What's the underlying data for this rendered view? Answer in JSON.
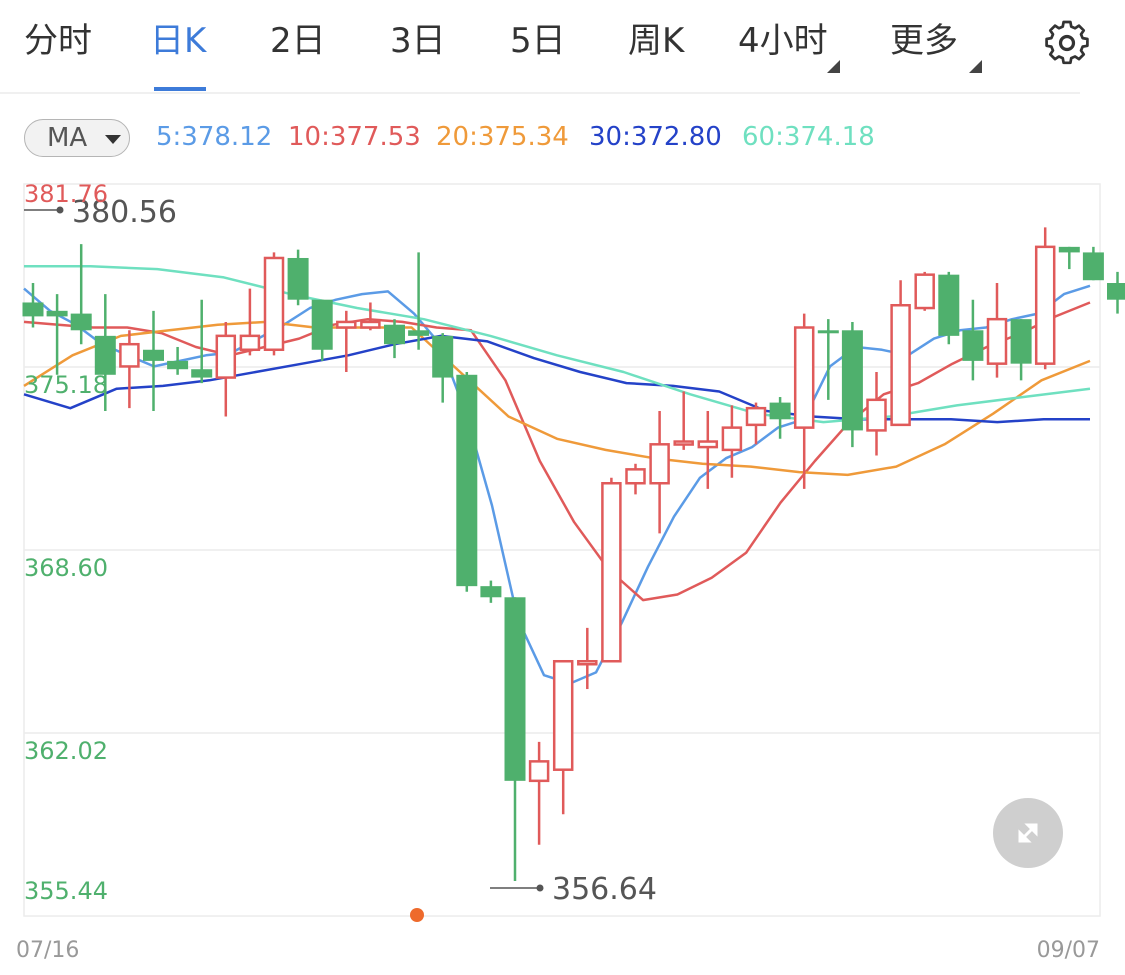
{
  "tabs": [
    {
      "label": "分时",
      "active": false
    },
    {
      "label": "日K",
      "active": true
    },
    {
      "label": "2日",
      "active": false
    },
    {
      "label": "3日",
      "active": false
    },
    {
      "label": "5日",
      "active": false
    },
    {
      "label": "周K",
      "active": false
    },
    {
      "label": "4小时",
      "active": false
    },
    {
      "label": "更多",
      "active": false
    }
  ],
  "settings_icon": "gear-icon",
  "expand_icon": "expand-arrows-icon",
  "indicator": {
    "selector_label": "MA",
    "values": [
      {
        "label": "5:378.12",
        "color": "#5b9be6"
      },
      {
        "label": "10:377.53",
        "color": "#e05a5a"
      },
      {
        "label": "20:375.34",
        "color": "#ef9a3a"
      },
      {
        "label": "30:372.80",
        "color": "#2442c8"
      },
      {
        "label": "60:374.18",
        "color": "#6fe0c0"
      }
    ]
  },
  "colors": {
    "up": "#e05a5a",
    "down": "#4fb06d",
    "accent": "#3d7bd9",
    "marker": "#ee6a2c"
  },
  "chart_data": {
    "type": "candlestick",
    "x_start_label": "07/16",
    "x_end_label": "09/07",
    "y_tick_labels": [
      "381.76",
      "375.18",
      "368.60",
      "362.02",
      "355.44"
    ],
    "ylim": [
      355.44,
      381.76
    ],
    "max_annotation": "380.56",
    "min_annotation": "356.64",
    "grid": true,
    "candles": [
      [
        377.5,
        377.0,
        378.2,
        376.6
      ],
      [
        377.2,
        377.0,
        377.8,
        374.9
      ],
      [
        377.1,
        376.5,
        379.6,
        376.0
      ],
      [
        376.3,
        374.9,
        377.8,
        373.6
      ],
      [
        375.2,
        376.0,
        376.5,
        373.7
      ],
      [
        375.8,
        375.4,
        377.2,
        373.6
      ],
      [
        375.4,
        375.1,
        375.9,
        374.9
      ],
      [
        375.1,
        374.8,
        377.6,
        374.6
      ],
      [
        374.8,
        376.3,
        376.8,
        373.4
      ],
      [
        375.8,
        376.3,
        378.0,
        375.6
      ],
      [
        375.8,
        379.1,
        379.3,
        375.6
      ],
      [
        379.1,
        377.6,
        379.4,
        377.4
      ],
      [
        377.6,
        375.8,
        377.6,
        375.4
      ],
      [
        376.6,
        376.8,
        377.2,
        375.0
      ],
      [
        376.6,
        376.8,
        377.5,
        376.5
      ],
      [
        376.7,
        376.0,
        376.9,
        375.5
      ],
      [
        376.5,
        376.3,
        379.3,
        375.8
      ],
      [
        376.3,
        374.8,
        376.4,
        373.9
      ],
      [
        374.9,
        367.3,
        375.0,
        367.1
      ],
      [
        367.3,
        366.9,
        367.5,
        366.7
      ],
      [
        366.9,
        360.3,
        366.9,
        356.7
      ],
      [
        360.3,
        361.0,
        361.7,
        358.0
      ],
      [
        360.7,
        364.6,
        364.6,
        359.1
      ],
      [
        364.5,
        364.6,
        365.8,
        363.6
      ],
      [
        364.6,
        371.0,
        371.2,
        364.6
      ],
      [
        371.0,
        371.5,
        371.7,
        370.6
      ],
      [
        371.0,
        372.4,
        373.6,
        369.2
      ],
      [
        372.4,
        372.5,
        374.3,
        372.2
      ],
      [
        372.3,
        372.5,
        373.6,
        370.8
      ],
      [
        372.2,
        373.0,
        373.8,
        371.2
      ],
      [
        373.1,
        373.7,
        373.9,
        372.4
      ],
      [
        373.9,
        373.3,
        374.1,
        372.6
      ],
      [
        373.0,
        376.6,
        377.1,
        370.8
      ],
      [
        376.5,
        376.4,
        376.9,
        374.0
      ],
      [
        376.5,
        372.9,
        376.8,
        372.3
      ],
      [
        372.9,
        374.0,
        375.0,
        372.0
      ],
      [
        373.1,
        377.4,
        378.3,
        373.2
      ],
      [
        377.3,
        378.5,
        378.6,
        377.2
      ],
      [
        378.5,
        376.3,
        378.6,
        376.0
      ],
      [
        376.5,
        375.4,
        377.6,
        374.7
      ],
      [
        375.3,
        376.9,
        378.2,
        374.8
      ],
      [
        376.9,
        375.3,
        376.9,
        374.7
      ],
      [
        375.3,
        379.5,
        380.2,
        375.1
      ],
      [
        379.5,
        379.3,
        379.5,
        378.7
      ],
      [
        379.3,
        378.3,
        379.5,
        378.3
      ],
      [
        378.2,
        377.6,
        378.6,
        377.1
      ]
    ],
    "series": [
      {
        "name": "5",
        "color": "#5b9be6",
        "y": [
          378.0,
          377.2,
          376.7,
          376.0,
          375.6,
          375.2,
          375.4,
          375.6,
          375.7,
          376.2,
          376.7,
          377.3,
          377.6,
          377.8,
          377.9,
          377.1,
          376.0,
          373.5,
          370.2,
          366.1,
          364.1,
          363.8,
          364.2,
          366.0,
          368.0,
          369.8,
          371.2,
          371.9,
          372.3,
          373.0,
          373.3,
          375.2,
          375.9,
          375.8,
          375.6,
          376.2,
          376.5,
          376.6,
          376.9,
          377.1,
          377.8,
          378.1
        ]
      },
      {
        "name": "10",
        "color": "#e05a5a",
        "y": [
          376.8,
          376.7,
          376.6,
          376.6,
          376.4,
          375.9,
          375.6,
          375.9,
          376.2,
          376.7,
          376.9,
          376.8,
          376.6,
          376.5,
          374.7,
          371.8,
          369.6,
          367.9,
          366.8,
          367.0,
          367.6,
          368.5,
          370.3,
          371.8,
          373.2,
          374.2,
          374.6,
          375.3,
          375.9,
          376.4,
          377.0,
          377.5
        ]
      },
      {
        "name": "20",
        "color": "#ef9a3a",
        "y": [
          374.5,
          375.6,
          376.3,
          376.5,
          376.7,
          376.8,
          376.6,
          376.6,
          376.6,
          375.0,
          373.4,
          372.6,
          372.2,
          371.9,
          371.7,
          371.6,
          371.4,
          371.3,
          371.6,
          372.4,
          373.5,
          374.7,
          375.4
        ]
      },
      {
        "name": "30",
        "color": "#2442c8",
        "y": [
          374.2,
          373.7,
          374.4,
          374.5,
          374.7,
          375.0,
          375.3,
          375.6,
          376.0,
          376.3,
          376.1,
          375.5,
          375.0,
          374.6,
          374.5,
          374.3,
          373.6,
          373.4,
          373.3,
          373.3,
          373.3,
          373.2,
          373.3,
          373.3
        ]
      },
      {
        "name": "60",
        "color": "#6fe0c0",
        "y": [
          378.8,
          378.8,
          378.7,
          378.4,
          377.8,
          377.3,
          376.9,
          376.3,
          375.6,
          375.0,
          374.2,
          373.5,
          373.2,
          373.4,
          373.8,
          374.1,
          374.4
        ]
      }
    ]
  }
}
